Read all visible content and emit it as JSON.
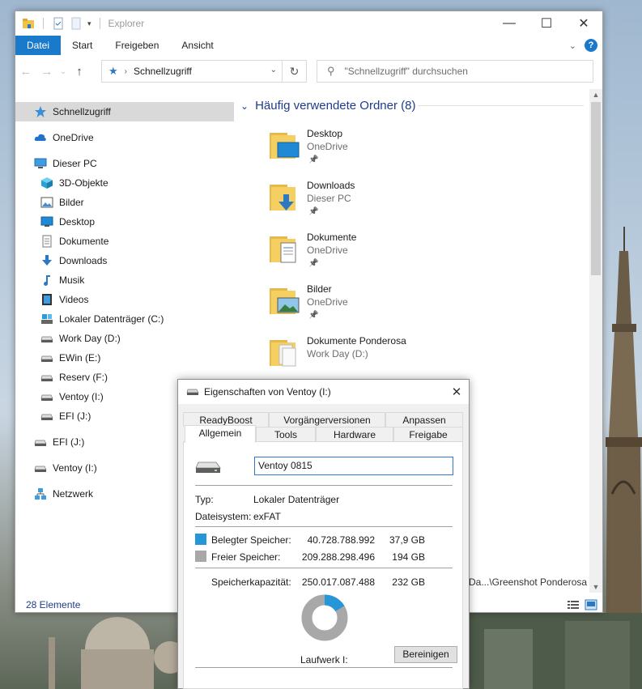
{
  "explorer": {
    "title": "Explorer",
    "ribbon_tabs": [
      "Datei",
      "Start",
      "Freigeben",
      "Ansicht"
    ],
    "breadcrumb": "Schnellzugriff",
    "search_placeholder": "\"Schnellzugriff\" durchsuchen",
    "nav": [
      {
        "label": "Schnellzugriff",
        "icon": "star-icon",
        "level": 0,
        "selected": true
      },
      {
        "label": "OneDrive",
        "icon": "cloud-icon",
        "level": 0
      },
      {
        "label": "Dieser PC",
        "icon": "monitor-icon",
        "level": 0
      },
      {
        "label": "3D-Objekte",
        "icon": "cube-icon",
        "level": 1
      },
      {
        "label": "Bilder",
        "icon": "pictures-icon",
        "level": 1
      },
      {
        "label": "Desktop",
        "icon": "desktop-icon",
        "level": 1
      },
      {
        "label": "Dokumente",
        "icon": "documents-icon",
        "level": 1
      },
      {
        "label": "Downloads",
        "icon": "download-icon",
        "level": 1
      },
      {
        "label": "Musik",
        "icon": "music-icon",
        "level": 1
      },
      {
        "label": "Videos",
        "icon": "video-icon",
        "level": 1
      },
      {
        "label": "Lokaler Datenträger (C:)",
        "icon": "system-drive-icon",
        "level": 1
      },
      {
        "label": "Work Day (D:)",
        "icon": "drive-icon",
        "level": 1
      },
      {
        "label": "EWin (E:)",
        "icon": "drive-icon",
        "level": 1
      },
      {
        "label": "Reserv (F:)",
        "icon": "drive-icon",
        "level": 1
      },
      {
        "label": "Ventoy (I:)",
        "icon": "drive-icon",
        "level": 1
      },
      {
        "label": "EFI (J:)",
        "icon": "drive-icon",
        "level": 1
      },
      {
        "label": "EFI (J:)",
        "icon": "drive-icon",
        "level": 0
      },
      {
        "label": "Ventoy (I:)",
        "icon": "drive-icon",
        "level": 0
      },
      {
        "label": "Netzwerk",
        "icon": "network-icon",
        "level": 0
      }
    ],
    "group_title": "Häufig verwendete Ordner (8)",
    "folders": [
      {
        "name": "Desktop",
        "location": "OneDrive",
        "pinned": true,
        "icon": "desktop-folder-icon"
      },
      {
        "name": "Downloads",
        "location": "Dieser PC",
        "pinned": true,
        "icon": "downloads-folder-icon"
      },
      {
        "name": "Dokumente",
        "location": "OneDrive",
        "pinned": true,
        "icon": "documents-folder-icon"
      },
      {
        "name": "Bilder",
        "location": "OneDrive",
        "pinned": true,
        "icon": "pictures-folder-icon"
      },
      {
        "name": "Dokumente Ponderosa",
        "location": "Work Day (D:)",
        "pinned": false,
        "icon": "folder-icon"
      }
    ],
    "background_path": "Da...\\Greenshot Ponderosa",
    "status_count": "28 Elemente"
  },
  "dialog": {
    "title": "Eigenschaften von Ventoy (I:)",
    "tabs_row1": [
      "ReadyBoost",
      "Vorgängerversionen",
      "Anpassen"
    ],
    "tabs_row2": [
      "Allgemein",
      "Tools",
      "Hardware",
      "Freigabe"
    ],
    "drive_name": "Ventoy 0815",
    "type_label": "Typ:",
    "type_value": "Lokaler Datenträger",
    "fs_label": "Dateisystem:",
    "fs_value": "exFAT",
    "used_label": "Belegter Speicher:",
    "used_bytes": "40.728.788.992",
    "used_gb": "37,9 GB",
    "free_label": "Freier Speicher:",
    "free_bytes": "209.288.298.496",
    "free_gb": "194 GB",
    "cap_label": "Speicherkapazität:",
    "cap_bytes": "250.017.087.488",
    "cap_gb": "232 GB",
    "used_fraction": 0.163,
    "drive_label": "Laufwerk I:",
    "cleanup_button": "Bereinigen",
    "colors": {
      "used": "#2597d9",
      "free": "#a8a8a8"
    }
  }
}
